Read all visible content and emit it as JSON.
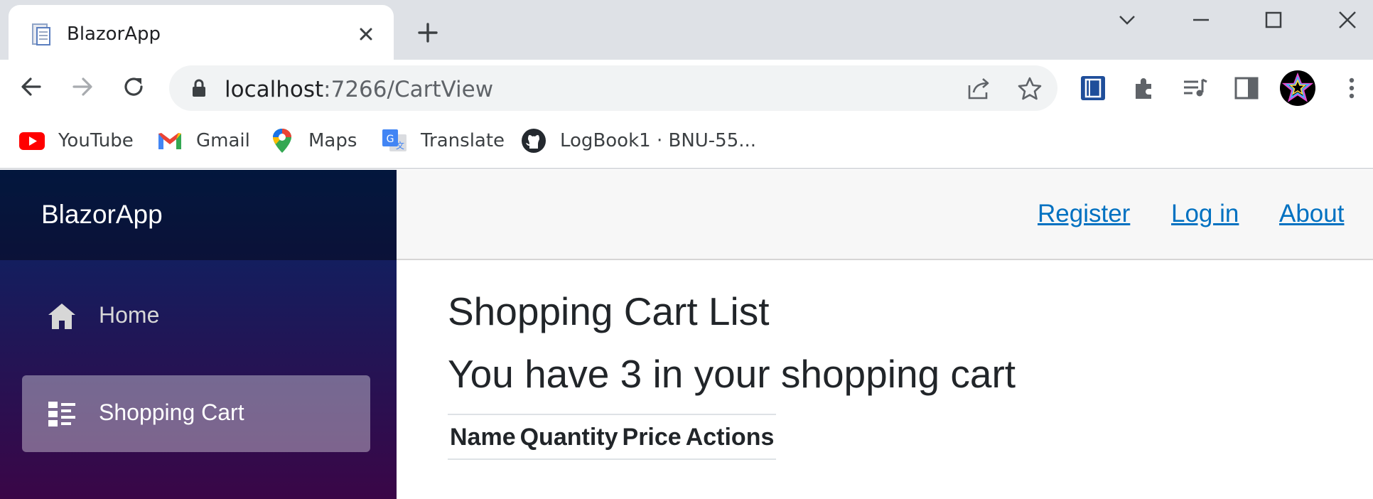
{
  "browser": {
    "tab": {
      "title": "BlazorApp"
    },
    "address": {
      "host": "localhost",
      "path": ":7266/CartView"
    },
    "bookmarks": [
      {
        "label": "YouTube",
        "icon": "youtube-icon"
      },
      {
        "label": "Gmail",
        "icon": "gmail-icon"
      },
      {
        "label": "Maps",
        "icon": "maps-icon"
      },
      {
        "label": "Translate",
        "icon": "translate-icon"
      },
      {
        "label": "LogBook1 · BNU-55...",
        "icon": "github-icon"
      }
    ]
  },
  "app": {
    "brand": "BlazorApp",
    "nav": [
      {
        "label": "Home",
        "icon": "home-icon",
        "active": false
      },
      {
        "label": "Shopping Cart",
        "icon": "list-icon",
        "active": true
      }
    ],
    "top_links": [
      "Register",
      "Log in",
      "About"
    ],
    "page": {
      "title": "Shopping Cart List",
      "subtitle": "You have 3 in your shopping cart",
      "table_headers": [
        "Name",
        "Quantity",
        "Price",
        "Actions"
      ]
    }
  },
  "colors": {
    "sidebar_top": "#052767",
    "sidebar_bottom": "#3a0647",
    "link": "#0071c1",
    "tabstrip": "#dee1e6"
  }
}
